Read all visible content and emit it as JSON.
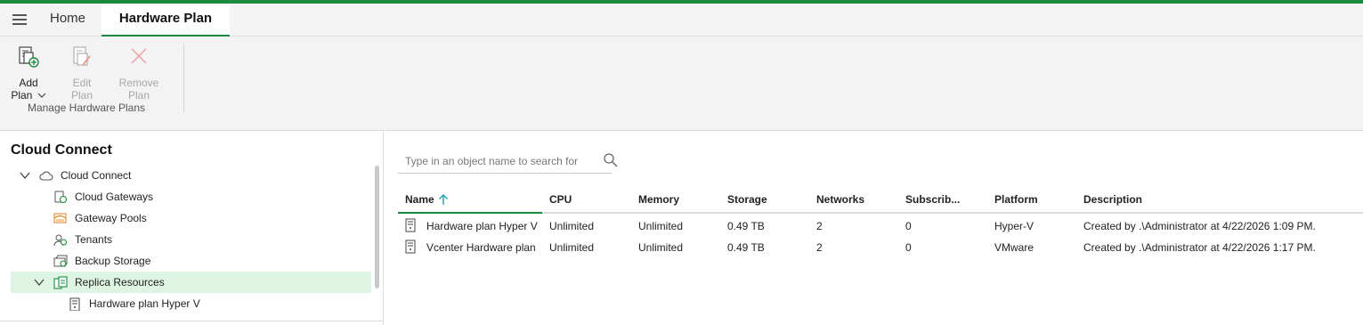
{
  "tabs": {
    "home": "Home",
    "hardware_plan": "Hardware Plan"
  },
  "ribbon": {
    "add_plan": {
      "line1": "Add",
      "line2": "Plan"
    },
    "edit_plan": {
      "line1": "Edit",
      "line2": "Plan"
    },
    "remove_plan": {
      "line1": "Remove",
      "line2": "Plan"
    },
    "group_label": "Manage Hardware Plans"
  },
  "left_panel": {
    "title": "Cloud Connect",
    "tree": [
      {
        "label": "Cloud Connect",
        "icon": "cloud-icon"
      },
      {
        "label": "Cloud Gateways",
        "icon": "gateway-icon"
      },
      {
        "label": "Gateway Pools",
        "icon": "gateway-pool-icon"
      },
      {
        "label": "Tenants",
        "icon": "tenants-icon"
      },
      {
        "label": "Backup Storage",
        "icon": "backup-storage-icon"
      },
      {
        "label": "Replica Resources",
        "icon": "replica-resources-icon"
      },
      {
        "label": "Hardware plan Hyper V",
        "icon": "hardware-plan-icon"
      }
    ]
  },
  "search": {
    "placeholder": "Type in an object name to search for"
  },
  "grid": {
    "columns": [
      "Name",
      "CPU",
      "Memory",
      "Storage",
      "Networks",
      "Subscrib...",
      "Platform",
      "Description"
    ],
    "rows": [
      [
        "Hardware plan Hyper V",
        "Unlimited",
        "Unlimited",
        "0.49 TB",
        "2",
        "0",
        "Hyper-V",
        "Created by .\\Administrator at 4/22/2026 1:09 PM."
      ],
      [
        "Vcenter Hardware plan",
        "Unlimited",
        "Unlimited",
        "0.49 TB",
        "2",
        "0",
        "VMware",
        "Created by .\\Administrator at 4/22/2026 1:17 PM."
      ]
    ]
  },
  "colors": {
    "accent": "#1a8a3c",
    "selected_row": "#ddf5e2"
  }
}
